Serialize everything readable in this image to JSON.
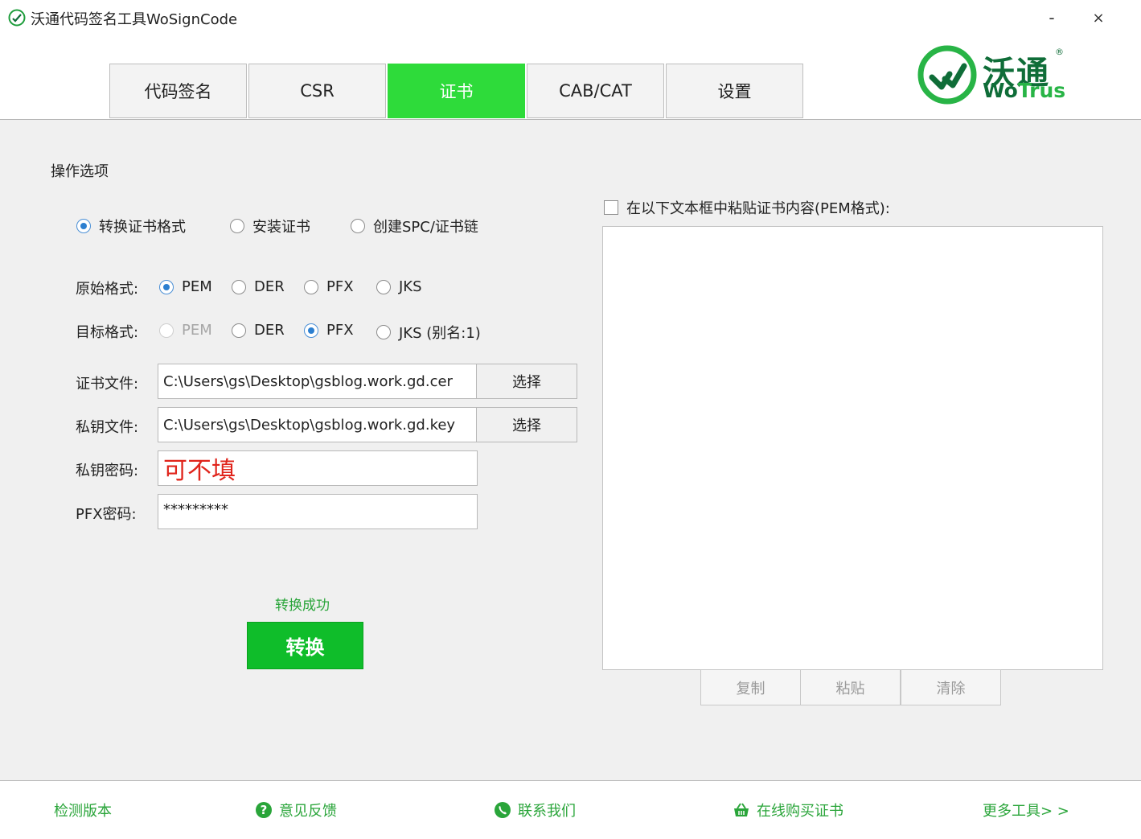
{
  "window": {
    "title": "沃通代码签名工具WoSignCode",
    "minimize_label": "-",
    "close_label": "×"
  },
  "tabs": [
    {
      "label": "代码签名",
      "active": false
    },
    {
      "label": "CSR",
      "active": false
    },
    {
      "label": "证书",
      "active": true
    },
    {
      "label": "CAB/CAT",
      "active": false
    },
    {
      "label": "设置",
      "active": false
    }
  ],
  "logo": {
    "cn": "沃通",
    "en_wo": "Wo",
    "en_trus": "Trus",
    "reg": "®"
  },
  "options": {
    "section_title": "操作选项",
    "modes": [
      {
        "label": "转换证书格式",
        "selected": true
      },
      {
        "label": "安装证书",
        "selected": false
      },
      {
        "label": "创建SPC/证书链",
        "selected": false
      }
    ]
  },
  "source_format": {
    "label": "原始格式:",
    "choices": [
      {
        "label": "PEM",
        "selected": true,
        "disabled": false
      },
      {
        "label": "DER",
        "selected": false,
        "disabled": false
      },
      {
        "label": "PFX",
        "selected": false,
        "disabled": false
      },
      {
        "label": "JKS",
        "selected": false,
        "disabled": false
      }
    ]
  },
  "target_format": {
    "label": "目标格式:",
    "choices": [
      {
        "label": "PEM",
        "selected": false,
        "disabled": true
      },
      {
        "label": "DER",
        "selected": false,
        "disabled": false
      },
      {
        "label": "PFX",
        "selected": true,
        "disabled": false
      },
      {
        "label": "JKS (别名:1)",
        "selected": false,
        "disabled": false
      }
    ]
  },
  "fields": {
    "cert_file_label": "证书文件:",
    "cert_file_value": "C:\\Users\\gs\\Desktop\\gsblog.work.gd.cer",
    "cert_file_button": "选择",
    "key_file_label": "私钥文件:",
    "key_file_value": "C:\\Users\\gs\\Desktop\\gsblog.work.gd.key",
    "key_file_button": "选择",
    "key_pwd_label": "私钥密码:",
    "key_pwd_annotation": "可不填",
    "pfx_pwd_label": "PFX密码:",
    "pfx_pwd_value": "*********"
  },
  "convert": {
    "status": "转换成功",
    "button": "转换"
  },
  "paste": {
    "checkbox_label": "在以下文本框中粘贴证书内容(PEM格式):",
    "checked": false,
    "textarea_value": "",
    "copy_button": "复制",
    "paste_button": "粘贴",
    "clear_button": "清除"
  },
  "footer": {
    "check_version": "检测版本",
    "feedback": "意见反馈",
    "contact": "联系我们",
    "buy": "在线购买证书",
    "more_tools": "更多工具> >"
  },
  "colors": {
    "accent_green": "#2edb3a",
    "button_green": "#0fbd2a",
    "link_green": "#2aa53a",
    "annotation_red": "#e0241b",
    "logo_dark_green": "#0f6d38"
  }
}
